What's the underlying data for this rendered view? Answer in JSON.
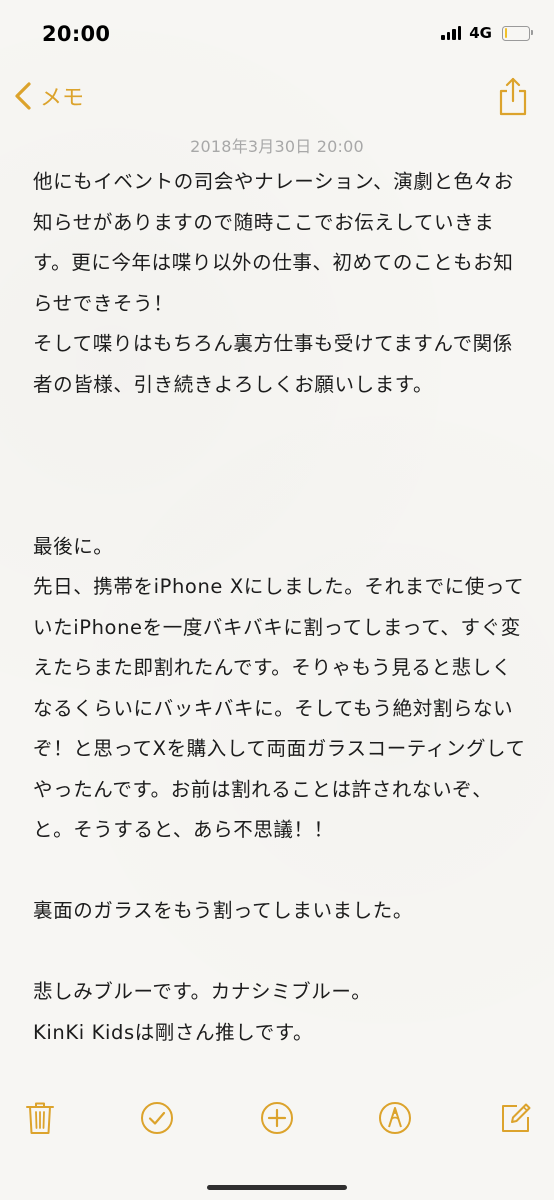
{
  "status_bar": {
    "time": "20:00",
    "network": "4G",
    "battery_level": 0.12
  },
  "nav": {
    "back_label": "メモ",
    "icons": {
      "back": "chevron-left-icon",
      "share": "share-icon"
    }
  },
  "note": {
    "date": "2018年3月30日 20:00",
    "paragraphs": [
      "他にもイベントの司会やナレーション、演劇と色々お知らせがありますので随時ここでお伝えしていきます。更に今年は喋り以外の仕事、初めてのこともお知らせできそう！\nそして喋りはもちろん裏方仕事も受けてますんで関係者の皆様、引き続きよろしくお願いします。",
      "",
      "",
      "",
      "最後に。\n先日、携帯をiPhone Xにしました。それまでに使っていたiPhoneを一度バキバキに割ってしまって、すぐ変えたらまた即割れたんです。そりゃもう見ると悲しくなるくらいにバッキバキに。そしてもう絶対割らないぞ！と思ってXを購入して両面ガラスコーティングしてやったんです。お前は割れることは許されないぞ、と。そうすると、あら不思議！！",
      "",
      "裏面のガラスをもう割ってしまいました。",
      "",
      "悲しみブルーです。カナシミブルー。\nKinKi Kidsは剛さん推しです。"
    ]
  },
  "toolbar": {
    "icons": [
      "trash-icon",
      "checklist-icon",
      "add-icon",
      "markup-icon",
      "compose-icon"
    ]
  },
  "colors": {
    "accent": "#dca32c",
    "background": "#f7f6f3",
    "date_text": "#a8a8a8"
  }
}
